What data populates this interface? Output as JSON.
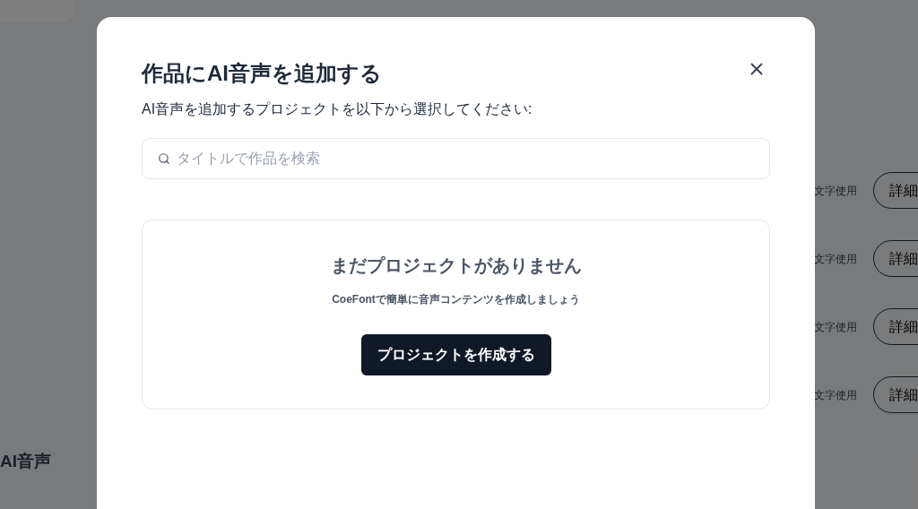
{
  "background": {
    "rows": [
      {
        "usage": "文字使用",
        "button": "詳細"
      },
      {
        "usage": "文字使用",
        "button": "詳細"
      },
      {
        "usage": "文字使用",
        "button": "詳細"
      },
      {
        "usage": "文字使用",
        "button": "詳細"
      }
    ],
    "section_title": "AI音声"
  },
  "dialog": {
    "title": "作品にAI音声を追加する",
    "instruction": "AI音声を追加するプロジェクトを以下から選択してください:",
    "search": {
      "placeholder": "タイトルで作品を検索"
    },
    "empty_state": {
      "heading": "まだプロジェクトがありません",
      "message": "CoeFontで簡単に音声コンテンツを作成しましょう",
      "button": "プロジェクトを作成する"
    }
  }
}
